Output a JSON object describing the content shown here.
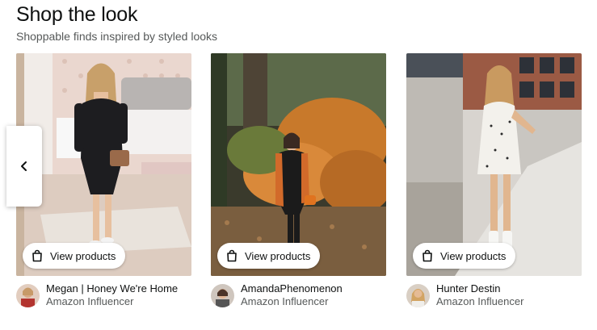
{
  "header": {
    "title": "Shop the look",
    "subtitle": "Shoppable finds inspired by styled looks"
  },
  "carousel": {
    "prev_icon": "chevron-left-icon",
    "cards": [
      {
        "button_label": "View products",
        "button_icon": "shopping-bag-icon",
        "creator_name": "Megan | Honey We're Home",
        "creator_role": "Amazon Influencer"
      },
      {
        "button_label": "View products",
        "button_icon": "shopping-bag-icon",
        "creator_name": "AmandaPhenomenon",
        "creator_role": "Amazon Influencer"
      },
      {
        "button_label": "View products",
        "button_icon": "shopping-bag-icon",
        "creator_name": "Hunter Destin",
        "creator_role": "Amazon Influencer"
      }
    ]
  },
  "colors": {
    "text_primary": "#0f1111",
    "text_secondary": "#565959",
    "button_bg": "#ffffff"
  }
}
